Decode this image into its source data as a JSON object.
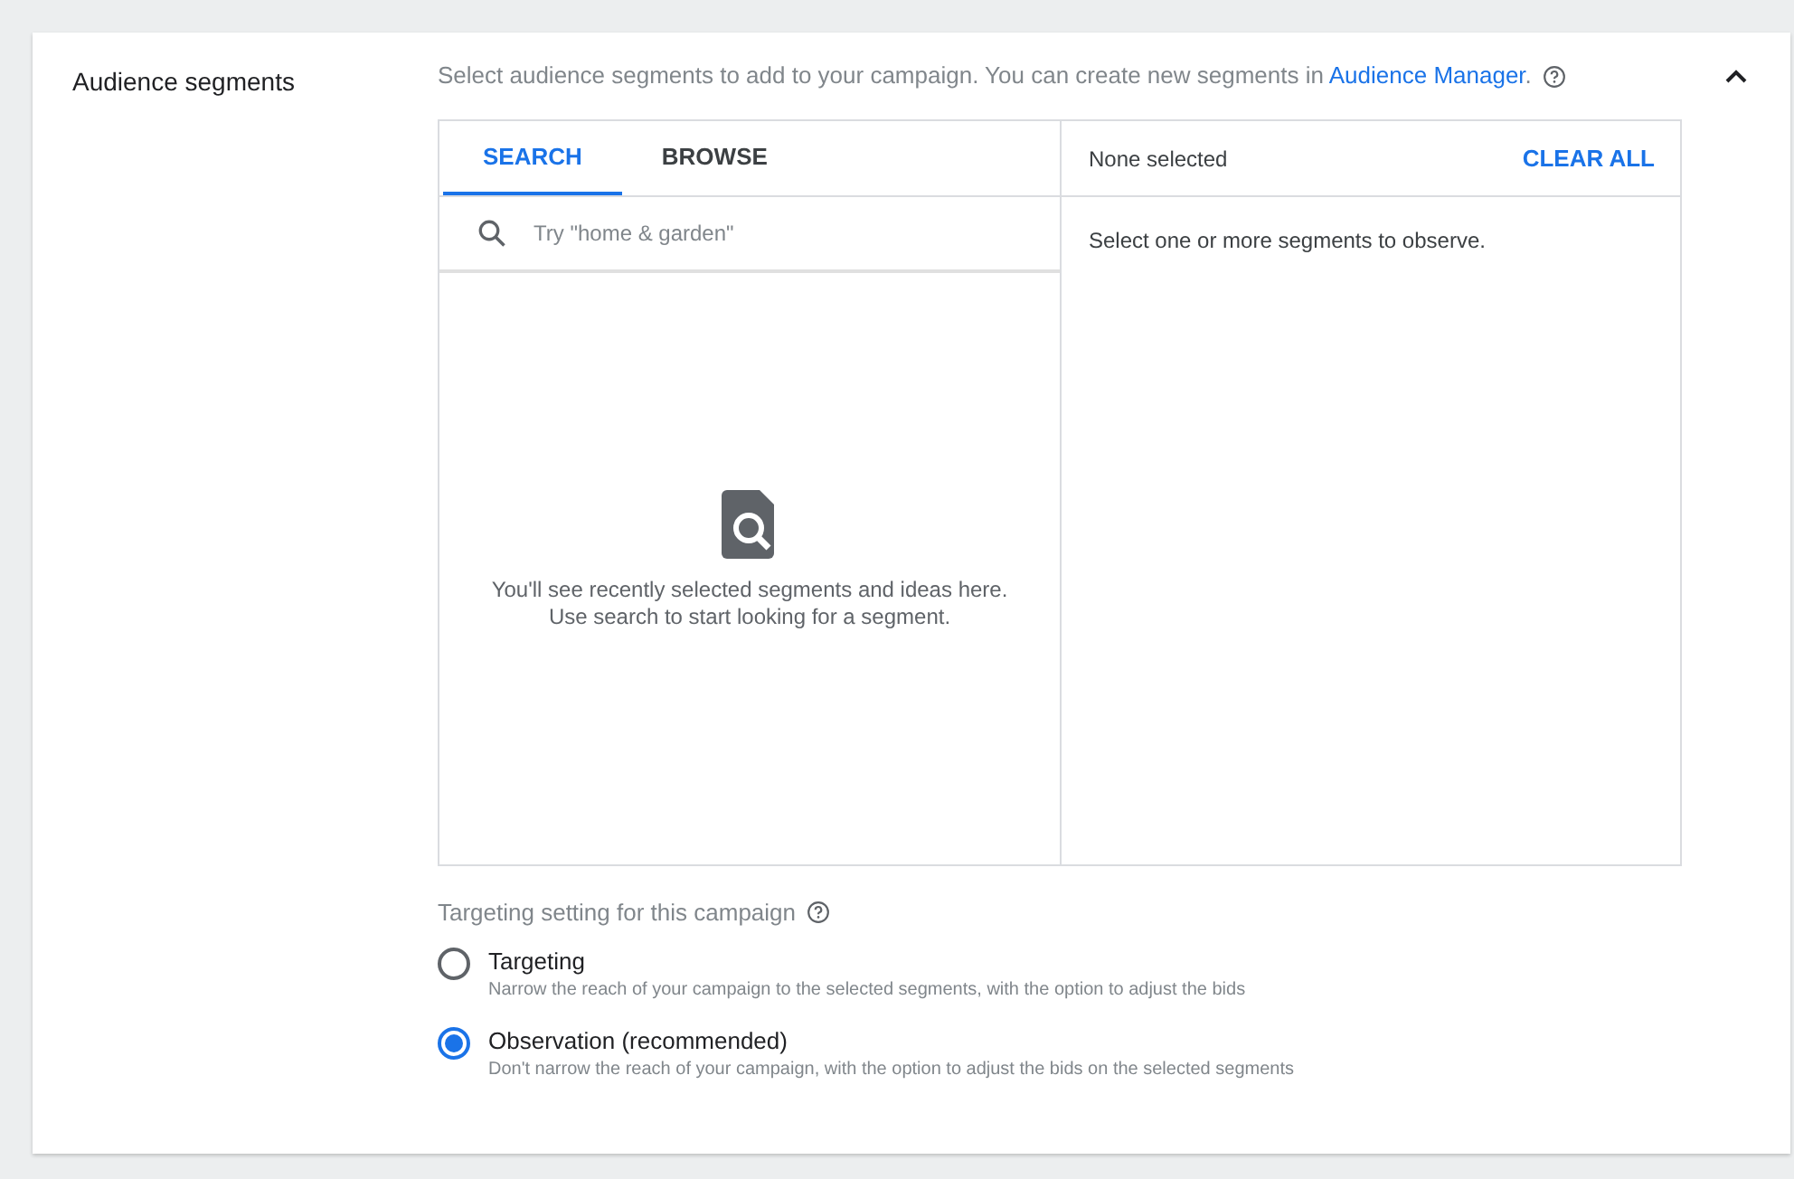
{
  "section": {
    "title": "Audience segments",
    "expanded": true,
    "description": {
      "before": "Select audience segments to add to your campaign. You can create new segments in ",
      "link": "Audience Manager",
      "after": "."
    }
  },
  "tabs": [
    {
      "label": "SEARCH",
      "selected": true
    },
    {
      "label": "BROWSE",
      "selected": false
    }
  ],
  "search": {
    "placeholder": "Try \"home & garden\""
  },
  "empty_state": {
    "lines": [
      "You'll see recently selected segments and ideas here.",
      "Use search to start looking for a segment."
    ]
  },
  "selection": {
    "summary": "None selected",
    "clear_button": "CLEAR ALL",
    "message": "Select one or more segments to observe."
  },
  "targeting": {
    "heading": "Targeting setting for this campaign",
    "options": [
      {
        "label": "Targeting",
        "description": "Narrow the reach of your campaign to the selected segments, with the option to adjust the bids",
        "selected": false
      },
      {
        "label": "Observation (recommended)",
        "description": "Don't narrow the reach of your campaign, with the option to adjust the bids on the selected segments",
        "selected": true
      }
    ]
  }
}
